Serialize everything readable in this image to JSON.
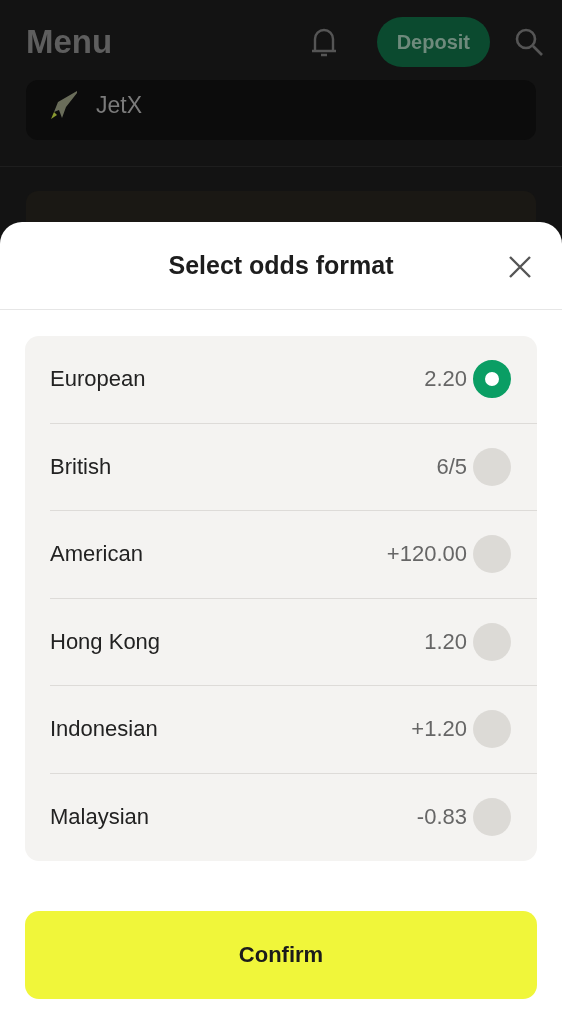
{
  "header": {
    "title": "Menu",
    "deposit_button": "Deposit"
  },
  "games": [
    {
      "label": "JetX"
    }
  ],
  "sheet": {
    "title": "Select odds format",
    "options": [
      {
        "label": "European",
        "value": "2.20",
        "selected": true
      },
      {
        "label": "British",
        "value": "6/5",
        "selected": false
      },
      {
        "label": "American",
        "value": "+120.00",
        "selected": false
      },
      {
        "label": "Hong Kong",
        "value": "1.20",
        "selected": false
      },
      {
        "label": "Indonesian",
        "value": "+1.20",
        "selected": false
      },
      {
        "label": "Malaysian",
        "value": "-0.83",
        "selected": false
      }
    ],
    "confirm_button": "Confirm"
  }
}
